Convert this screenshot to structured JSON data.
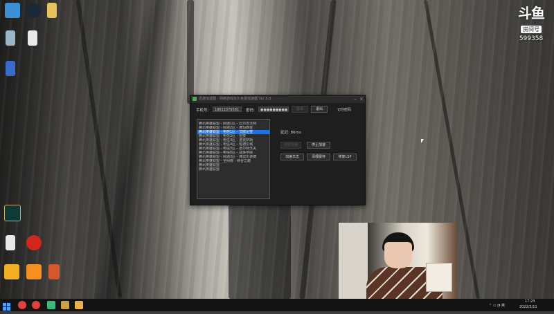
{
  "desktop": {
    "wallpaper": "cliff",
    "icons_top": [
      {
        "icon": "computer-icon",
        "color": "#3d8fd6"
      },
      {
        "icon": "steam-icon",
        "color": "#1b2838"
      },
      {
        "icon": "folder-icon",
        "color": "#e8c25b"
      },
      {
        "icon": "recycle-bin-icon",
        "color": "#9ab4c8"
      },
      {
        "icon": "file-icon",
        "color": "#e9e9e9"
      },
      {
        "icon": "app-icon",
        "color": "#3a6bc9"
      }
    ],
    "icons_bottom": [
      {
        "icon": "league-of-legends-icon",
        "color": "#0f3b36"
      },
      {
        "icon": "file-icon",
        "color": "#e9e9e9"
      },
      {
        "icon": "music-icon",
        "color": "#d0261c"
      },
      {
        "icon": "owl-icon",
        "color": "#f0b020"
      },
      {
        "icon": "tool-icon",
        "color": "#f58f1e"
      },
      {
        "icon": "game-icon",
        "color": "#d4582a"
      }
    ]
  },
  "watermark": {
    "logo": "斗鱼",
    "tag": "房间号",
    "room_number": "599358"
  },
  "app_window": {
    "title": "迅游加速器 - 网络游戏永久免费加速器 Ver 5.0",
    "phone_label": "手机号:",
    "phone_value": "18611379581",
    "password_label": "密码:",
    "password_value": "●●●●●●●●●",
    "login_button": "登录",
    "logout_button": "退出",
    "remember_link": "记住密码",
    "game_list": [
      "腾讯英雄联盟 - 网通1区 - 比尔吉沃特",
      "腾讯英雄联盟 - 网通2区 - 德玛西亚",
      "腾讯英雄联盟 - 电信1区 - 艾欧尼亚",
      "腾讯英雄联盟 - 电信2区 - 祖安",
      "腾讯英雄联盟 - 电信3区 - 诺克萨斯",
      "腾讯英雄联盟 - 电信4区 - 班德尔城",
      "腾讯英雄联盟 - 电信5区 - 皮尔特沃夫",
      "腾讯英雄联盟 - 电信6区 - 战争学院",
      "腾讯英雄联盟 - 网通3区 - 弗雷尔卓德",
      "腾讯英雄联盟 - 全网络 - 峡谷之巅",
      "腾讯英雄联盟",
      "腾讯英雄联盟"
    ],
    "selected_index": 2,
    "latency_label": "延迟: 86ms",
    "start_button": "开始加速",
    "stop_button": "停止加速",
    "log_button": "加速日志",
    "clear_button": "清理缓存",
    "repair_button": "修复LSP"
  },
  "taskbar": {
    "items": [
      {
        "icon": "windows-start-icon",
        "color": "#4ea1ff"
      },
      {
        "icon": "chrome-icon",
        "color": "#e0423b"
      },
      {
        "icon": "chrome-icon",
        "color": "#e0423b"
      },
      {
        "icon": "app-icon",
        "color": "#3cb878"
      },
      {
        "icon": "app-icon",
        "color": "#c8a14a"
      },
      {
        "icon": "app-icon",
        "color": "#e8b24a"
      }
    ],
    "clock_time": "17:23",
    "clock_date": "2022/3/11"
  }
}
